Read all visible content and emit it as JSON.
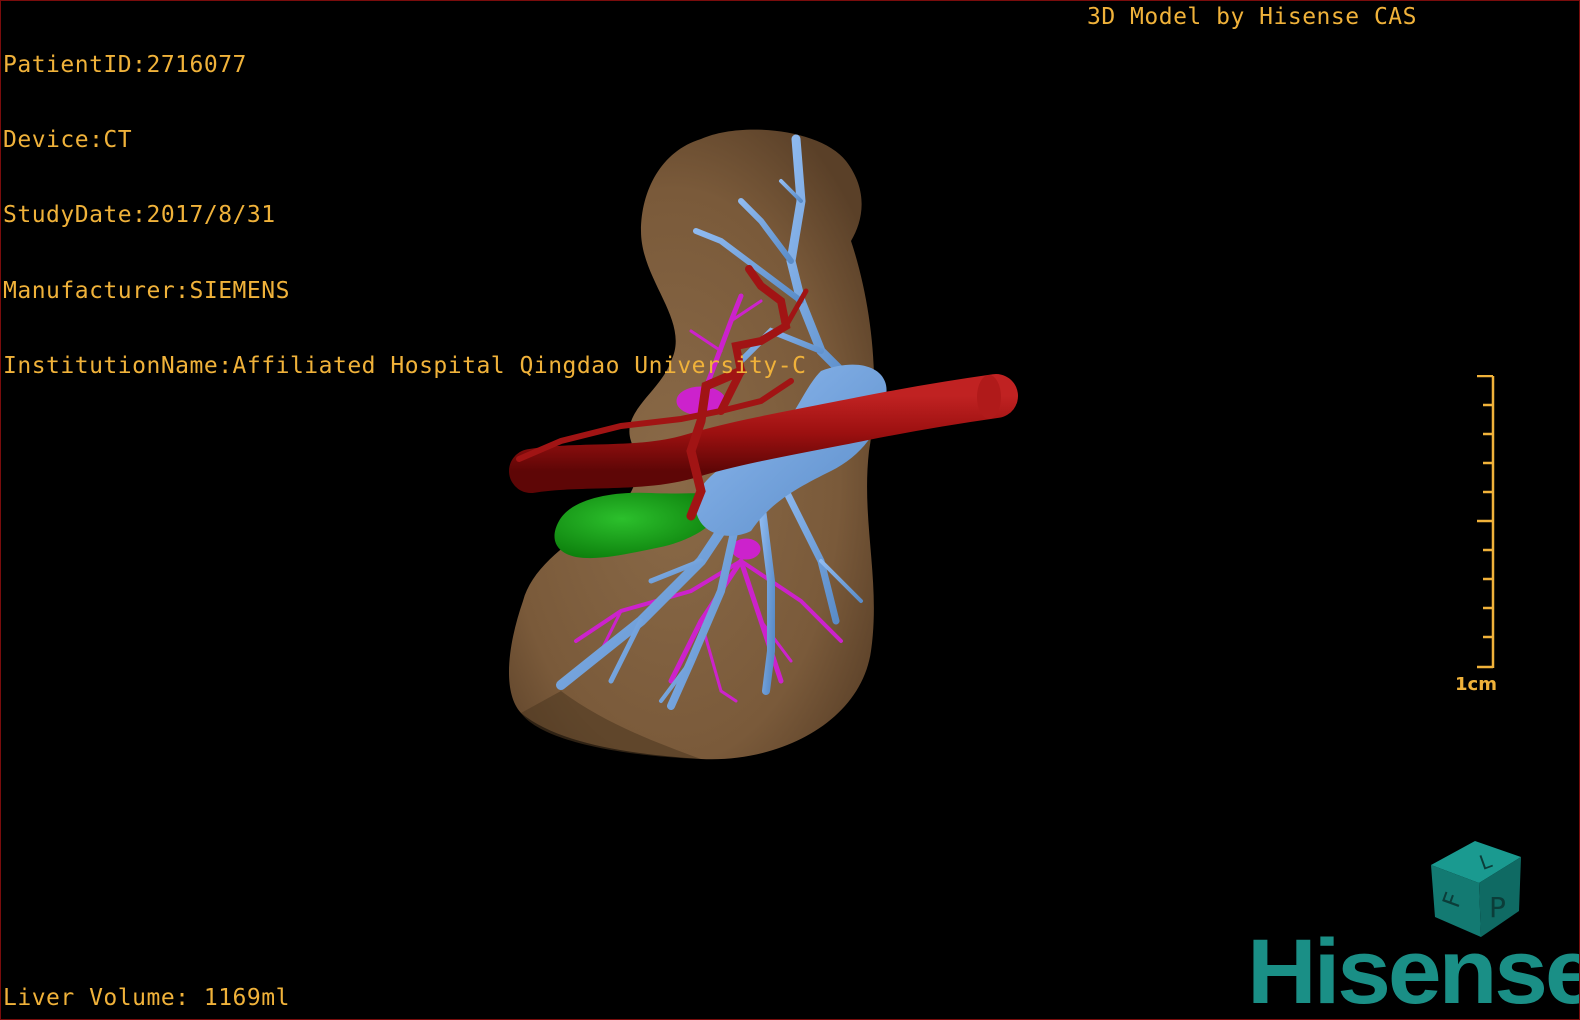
{
  "info": {
    "lines": [
      "PatientID:2716077",
      "Device:CT",
      "StudyDate:2017/8/31",
      "Manufacturer:SIEMENS",
      "InstitutionName:Affiliated Hospital Qingdao University-C"
    ]
  },
  "credit": "3D Model by Hisense CAS",
  "volume": "Liver Volume: 1169ml",
  "scale": {
    "label": "1cm"
  },
  "orientation_cube": {
    "faces": [
      "F",
      "L",
      "P"
    ]
  },
  "brand": {
    "logo_text": "Hisense"
  },
  "colors": {
    "overlay_text": "#f0b23a",
    "liver": "#7d5c3c",
    "artery": "#9b1010",
    "portal_vein": "#6fa3dc",
    "hepatic_vein": "#cc22cc",
    "gallbladder": "#16a016",
    "brand": "#1a8f86",
    "cube": "#137a72"
  },
  "model_structures": [
    "liver",
    "hepatic-artery",
    "portal-vein",
    "hepatic-vein",
    "gallbladder"
  ]
}
